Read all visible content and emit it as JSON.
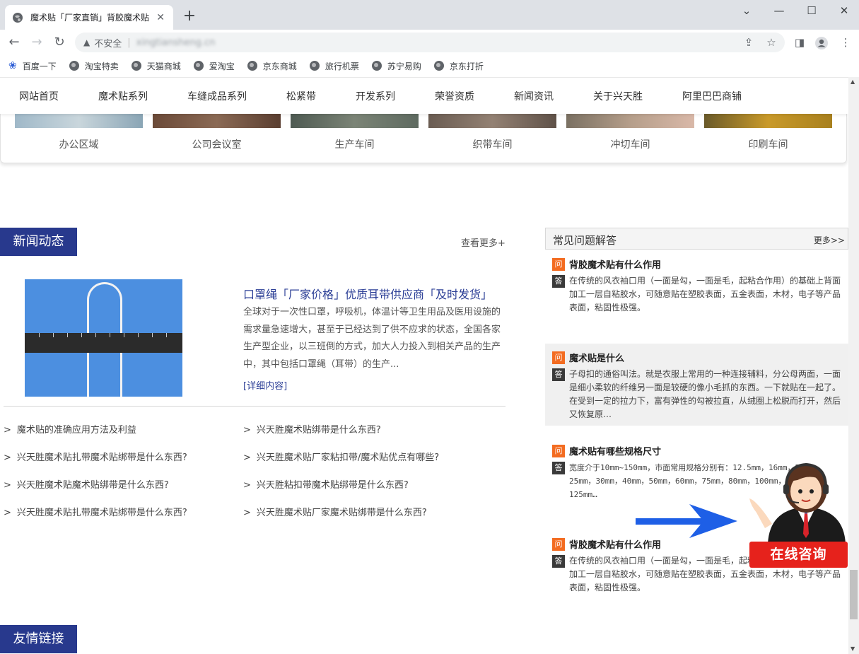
{
  "browser": {
    "tab_title": "魔术贴「厂家直销」背胶魔术贴定制",
    "security_label": "不安全",
    "url": "xingtiansheng.cn"
  },
  "bookmarks": [
    "百度一下",
    "淘宝特卖",
    "天猫商城",
    "爱淘宝",
    "京东商城",
    "旅行机票",
    "苏宁易购",
    "京东打折"
  ],
  "site_nav": [
    "网站首页",
    "魔术贴系列",
    "车缝成品系列",
    "松紧带",
    "开发系列",
    "荣誉资质",
    "新闻资讯",
    "关于兴天胜",
    "阿里巴巴商铺"
  ],
  "gallery_captions": [
    "办公区域",
    "公司会议室",
    "生产车间",
    "织带车间",
    "冲切车间",
    "印刷车间"
  ],
  "news": {
    "section_title": "新闻动态",
    "more_label": "查看更多+",
    "headline": "口罩绳「厂家价格」优质耳带供应商「及时发货」",
    "summary": "全球对于一次性口罩，呼吸机，体温计等卫生用品及医用设施的需求量急速增大，甚至于已经达到了供不应求的状态，全国各家生产型企业，以三班倒的方式，加大人力投入到相关产品的生产中，其中包括口罩绳（耳带）的生产...",
    "detail_label": "[详细内容]",
    "links_left": [
      "魔术贴的准确应用方法及利益",
      "兴天胜魔术贴扎带魔术贴绑带是什么东西?",
      "兴天胜魔术贴魔术贴绑带是什么东西?",
      "兴天胜魔术贴扎带魔术贴绑带是什么东西?"
    ],
    "links_right": [
      "兴天胜魔术贴绑带是什么东西?",
      "兴天胜魔术贴厂家粘扣带/魔术贴优点有哪些?",
      "兴天胜粘扣带魔术贴绑带是什么东西?",
      "兴天胜魔术贴厂家魔术贴绑带是什么东西?"
    ]
  },
  "faq": {
    "title": "常见问题解答",
    "more_label": "更多>>",
    "q_badge": "问",
    "a_badge": "答",
    "items": [
      {
        "q": "背胶魔术贴有什么作用",
        "a": "在传统的风衣袖口用（一面是勾，一面是毛，起粘合作用）的基础上背面加工一层自粘胶水，可随意贴在塑胶表面，五金表面，木材，电子等产品表面，粘固性极强。"
      },
      {
        "q": "魔术贴是什么",
        "a": "子母扣的通俗叫法。就是衣服上常用的一种连接辅料，分公母两面，一面是细小柔软的纤维另一面是较硬的像小毛抓的东西。一下就贴在一起了。在受到一定的拉力下，富有弹性的勾被拉直，从绒圈上松脱而打开，然后又恢复原…"
      },
      {
        "q": "魔术贴有哪些规格尺寸",
        "a": "宽度介于10mm~150mm，市面常用规格分别有：12.5mm，16mm，20mm，25mm，30mm，40mm，50mm，60mm，75mm，80mm，100mm，110mm，125mm…"
      },
      {
        "q": "背胶魔术贴有什么作用",
        "a": "在传统的风衣袖口用（一面是勾，一面是毛，起粘合作用）的基础上背面加工一层自粘胶水，可随意贴在塑胶表面，五金表面，木材，电子等产品表面，粘固性极强。"
      }
    ]
  },
  "consult_label": "在线咨询",
  "friend_links_title": "友情链接"
}
